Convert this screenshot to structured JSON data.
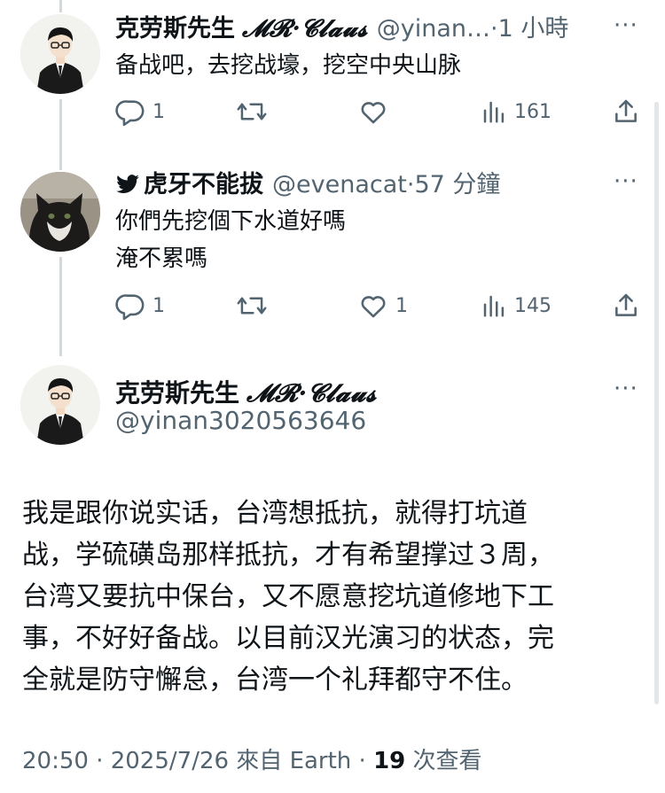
{
  "tweet1": {
    "name": "克劳斯先生",
    "name_stylized": "𝓜𝓡·𝓒𝓵𝓪𝓾𝓼",
    "handle": "@yinan…",
    "sep": "·",
    "time": "1 小時",
    "text": "备战吧，去挖战壕，挖空中央山脉",
    "more": "···",
    "actions": {
      "reply": "1",
      "retweet": "",
      "like": "",
      "views": "161"
    }
  },
  "tweet2": {
    "bird": "🐦",
    "name": "虎牙不能拔",
    "handle": "@evenacat",
    "sep": "·",
    "time": "57 分鐘",
    "text_line1": "你們先挖個下水道好嗎",
    "text_line2": "淹不累嗎",
    "more": "···",
    "actions": {
      "reply": "1",
      "retweet": "",
      "like": "1",
      "views": "145"
    }
  },
  "main_tweet": {
    "name": "克劳斯先生",
    "name_stylized": "𝓜𝓡·𝓒𝓵𝓪𝓾𝓼",
    "handle": "@yinan3020563646",
    "more": "···",
    "body_lines": [
      "我是跟你说实话，台湾想抵抗，就得打坑道",
      "战，学硫磺岛那样抵抗，才有希望撑过３周，",
      "台湾又要抗中保台，又不愿意挖坑道修地下工",
      "事，不好好备战。以目前汉光演习的状态，完",
      "全就是防守懈怠，台湾一个礼拜都守不住。"
    ],
    "meta_time": "20:50 · 2025/7/26 來自 Earth · ",
    "meta_views_count": "19",
    "meta_views_label": " 次查看"
  }
}
